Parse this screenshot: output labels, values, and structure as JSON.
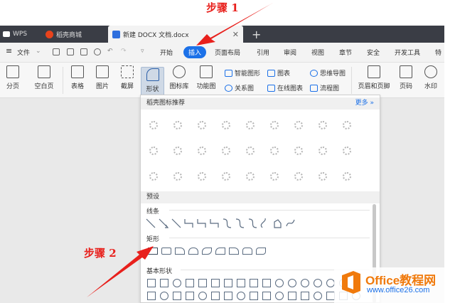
{
  "annotations": {
    "step1": "步骤 1",
    "step2": "步骤 2"
  },
  "tabs": [
    {
      "label": "WPS"
    },
    {
      "label": "稻壳商城"
    },
    {
      "label": "新建 DOCX 文档.docx"
    }
  ],
  "menu": {
    "file": "文件",
    "items": [
      "开始",
      "插入",
      "页面布局",
      "引用",
      "审阅",
      "视图",
      "章节",
      "安全",
      "开发工具",
      "特"
    ]
  },
  "ribbon": {
    "page_break": "分页",
    "blank_page": "空白页",
    "table": "表格",
    "picture": "图片",
    "screenshot": "截屏",
    "shape": "形状",
    "icon_lib": "图标库",
    "func_chart": "功能图",
    "smart_shape": "智能图形",
    "chart": "图表",
    "mindmap": "思维导图",
    "relation": "关系图",
    "online_chart": "在线图表",
    "flowchart": "流程图",
    "header_footer": "页眉和页脚",
    "page_number": "页码",
    "watermark": "水印"
  },
  "panel": {
    "recommend_title": "稻壳图标推荐",
    "more": "更多",
    "preset": "预设",
    "lines": "线条",
    "rect": "矩形",
    "basic": "基本形状"
  },
  "watermark_site": {
    "title": "Office教程网",
    "url": "www.office26.com"
  },
  "colors": {
    "accent": "#1c71e8",
    "arrow": "#e8201c",
    "tabbar": "#3a3d45",
    "watermark_orange": "#f07a0c"
  }
}
